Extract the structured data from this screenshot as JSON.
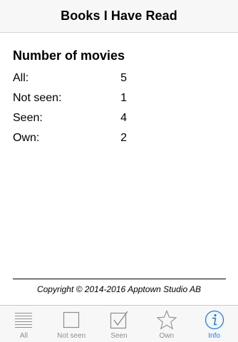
{
  "navbar": {
    "title": "Books I Have Read"
  },
  "stats": {
    "heading": "Number of movies",
    "rows": [
      {
        "label": "All:",
        "value": "5"
      },
      {
        "label": "Not seen:",
        "value": "1"
      },
      {
        "label": "Seen:",
        "value": "4"
      },
      {
        "label": "Own:",
        "value": "2"
      }
    ]
  },
  "footer": {
    "copyright": "Copyright © 2014-2016 Apptown Studio AB"
  },
  "tabbar": {
    "active": "Info",
    "tabs": [
      {
        "label": "All",
        "icon": "list-icon"
      },
      {
        "label": "Not seen",
        "icon": "empty-checkbox-icon"
      },
      {
        "label": "Seen",
        "icon": "checked-box-icon"
      },
      {
        "label": "Own",
        "icon": "star-icon"
      },
      {
        "label": "Info",
        "icon": "info-icon"
      }
    ]
  },
  "colors": {
    "accent": "#1a7ef2",
    "inactive": "#8e8e8e",
    "bar_bg": "#f7f7f7"
  }
}
